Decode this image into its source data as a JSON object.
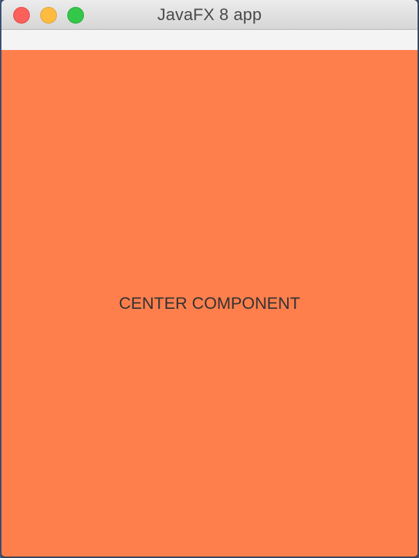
{
  "window": {
    "title": "JavaFX 8 app",
    "controls": [
      {
        "name": "close",
        "color": "#fc605b",
        "border": "#de4a44"
      },
      {
        "name": "minimize",
        "color": "#fdbc40",
        "border": "#dea236"
      },
      {
        "name": "maximize",
        "color": "#34c84a",
        "border": "#27aa35"
      }
    ]
  },
  "center": {
    "label": "CENTER COMPONENT",
    "background": "#ff7f4c"
  }
}
